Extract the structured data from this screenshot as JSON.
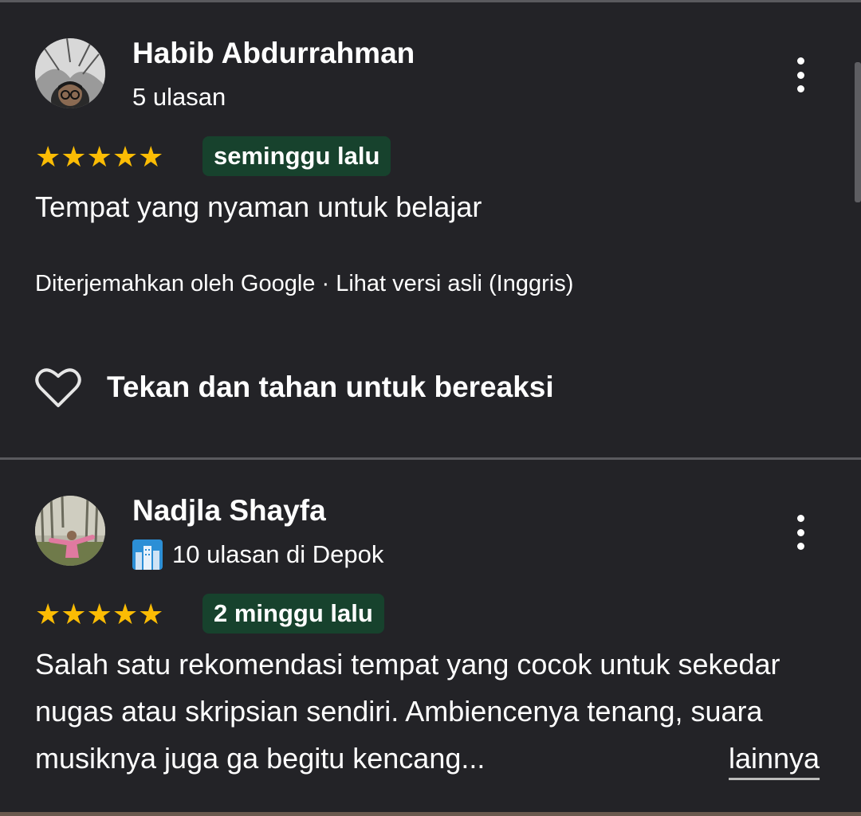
{
  "reviews": [
    {
      "name": "Habib Abdurrahman",
      "meta": "5 ulasan",
      "rating": 5,
      "stars": "★★★★★",
      "date": "seminggu lalu",
      "text": "Tempat yang nyaman untuk belajar",
      "translation": "Diterjemahkan oleh Google · Lihat versi asli (Inggris)",
      "reaction": "Tekan dan tahan untuk bereaksi"
    },
    {
      "name": "Nadjla Shayfa",
      "meta_icon": "city-emoji-icon",
      "meta": "10 ulasan di Depok",
      "rating": 5,
      "stars": "★★★★★",
      "date": "2 minggu lalu",
      "text": "Salah satu rekomendasi tempat yang cocok untuk sekedar nugas atau skripsian sendiri. Ambiencenya tenang, suara musiknya juga ga begitu kencang...",
      "more_label": "lainnya"
    }
  ],
  "colors": {
    "background": "#232327",
    "star": "#fbbc04",
    "date_badge": "#17422d",
    "divider": "#5a5a5e"
  }
}
